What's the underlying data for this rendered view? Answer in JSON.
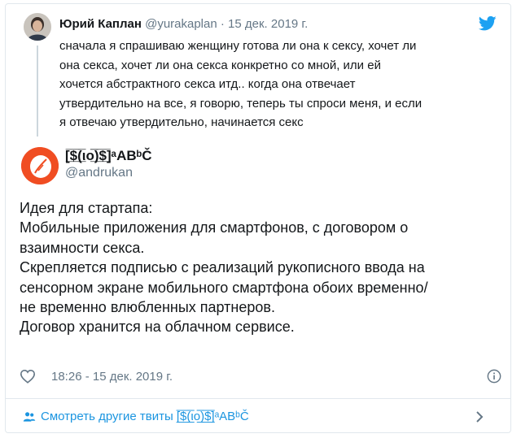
{
  "reply": {
    "name": "Юрий Каплан",
    "handle": "@yurakaplan",
    "dot": "·",
    "date": "15 дек. 2019 г.",
    "lines": [
      "сначала я спрашиваю женщину готова ли она к сексу, хочет ли",
      "она секса, хочет ли она секса конкретно со мной, или ей",
      "хочется абстрактного секса итд.. когда она отвечает",
      "утвердительно на все, я говорю, теперь ты спроси меня, и если",
      "я отвечаю утвердительно, начинается секс"
    ]
  },
  "tweet": {
    "name": "[̲̅$̲̅(̲̅ιο̲̅̅)̲̅$̲̅]ᵃABᵇČ",
    "handle": "@andrukan",
    "lines": [
      "Идея для стартапа:",
      "Мобильные приложения для смартфонов, с договором о",
      "взаимности секса.",
      "Скрепляется подписью с реализаций рукописного ввода на",
      "сенсорном экране мобильного смартфона обоих временно/",
      "не временно влюбленных партнеров.",
      "Договор хранится на облачном сервисе."
    ],
    "timestamp": "18:26 - 15 дек. 2019 г."
  },
  "footer": {
    "more_label": "Смотреть другие твиты [̲̅$̲̅(̲̅ιο̲̅̅)̲̅$̲̅]ᵃABᵇČ"
  },
  "colors": {
    "link": "#1b95e0",
    "muted": "#657786",
    "avatar_orange": "#f04d22"
  },
  "icons": [
    "twitter-bird-icon",
    "heart-icon",
    "info-icon",
    "people-icon",
    "chevron-right-icon"
  ]
}
